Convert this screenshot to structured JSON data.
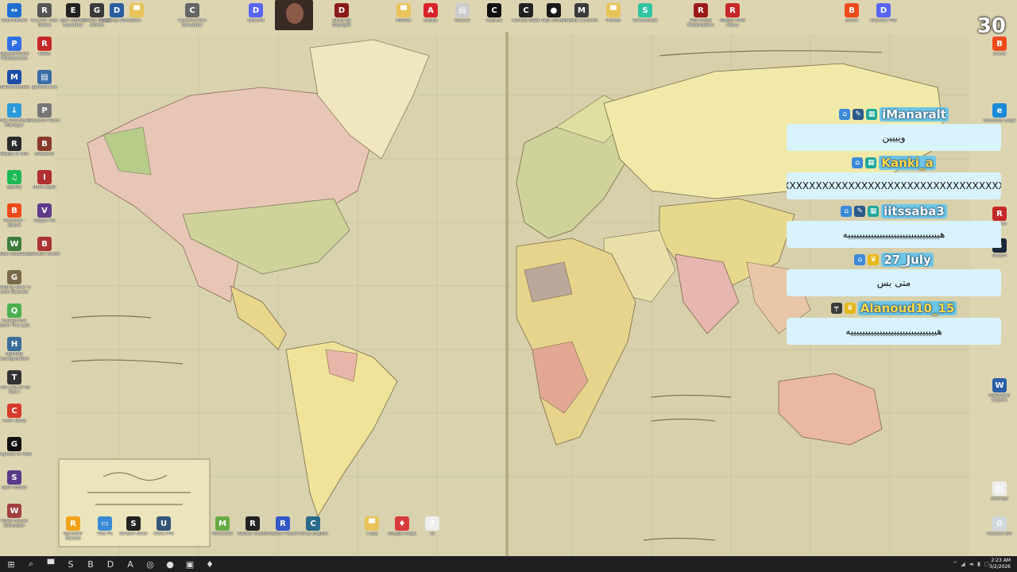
{
  "counter": "30",
  "chat": [
    {
      "user": "iManaralt",
      "badges": [
        "subscriber",
        "pen",
        "game"
      ],
      "text": "ويييين",
      "name_color": "#ffffff"
    },
    {
      "user": "Kanki_a",
      "badges": [
        "subscriber",
        "game"
      ],
      "text": "XXXXXXXXXXXXXXXXXXXXXXXXXXXXXXXXXXXXXX",
      "name_color": "#ffd84a"
    },
    {
      "user": "iitssaba3",
      "badges": [
        "subscriber",
        "pen",
        "game"
      ],
      "text": "هييييييييييييييييييييييييييييييييه",
      "name_color": "#ffffff"
    },
    {
      "user": "27_July",
      "badges": [
        "subscriber",
        "crown"
      ],
      "text": "متى بس",
      "name_color": "#ffffff"
    },
    {
      "user": "Alanoud10_15",
      "badges": [
        "gun",
        "crown"
      ],
      "text": "هييييييييييييييييييييييييييييييه",
      "name_color": "#ffd84a"
    }
  ],
  "desktop_left": [
    {
      "label": "TeamViewer",
      "icon": "teamviewer-icon",
      "color": "#1f6fd1",
      "glyph": "↔"
    },
    {
      "label": "Wondershare PDFelement",
      "icon": "pdfelement-icon",
      "color": "#2f6ee8",
      "glyph": "P"
    },
    {
      "label": "Malwarebytes",
      "icon": "malwarebytes-icon",
      "color": "#1d4ea8",
      "glyph": "M"
    },
    {
      "label": "Free Download Manager",
      "icon": "fdm-icon",
      "color": "#2b9ad8",
      "glyph": "↓"
    },
    {
      "label": "Ready or Not",
      "icon": "ready-or-not-icon",
      "color": "#2a2a2a",
      "glyph": "R"
    },
    {
      "label": "Spotify",
      "icon": "spotify-icon",
      "color": "#1db954",
      "glyph": "♫"
    },
    {
      "label": "Personal - Brave",
      "icon": "brave-icon",
      "color": "#f04a1c",
      "glyph": "B"
    },
    {
      "label": "Wisk Macbook",
      "icon": "wisk-icon",
      "color": "#3d7c3d",
      "glyph": "W"
    },
    {
      "label": "Getting Over It with Bennett",
      "icon": "getting-over-it-icon",
      "color": "#7a6a4a",
      "glyph": "G"
    },
    {
      "label": "Quarantine Zone The Last",
      "icon": "quarantine-zone-icon",
      "color": "#4caf50",
      "glyph": "Q"
    },
    {
      "label": "HidHide Configuration",
      "icon": "hidhide-icon",
      "color": "#3c6e9a",
      "glyph": "H"
    },
    {
      "label": "The Last of Us Part I",
      "icon": "last-of-us-icon",
      "color": "#333333",
      "glyph": "T"
    },
    {
      "label": "Core Temp",
      "icon": "core-temp-icon",
      "color": "#d83b2b",
      "glyph": "C"
    },
    {
      "label": "Logitech G HUB",
      "icon": "logitech-icon",
      "color": "#111111",
      "glyph": "G"
    },
    {
      "label": "Split Fiction",
      "icon": "split-fiction-icon",
      "color": "#5a3a8a",
      "glyph": "S"
    },
    {
      "label": "Wrap House Simulator",
      "icon": "wrap-house-icon",
      "color": "#a04040",
      "glyph": "W"
    }
  ],
  "desktop_left2": [
    {
      "label": "R.E.P.O. Like Demo",
      "icon": "repo-icon",
      "color": "#555555",
      "glyph": "R"
    },
    {
      "label": "RAGE",
      "icon": "rage-icon",
      "color": "#c62828",
      "glyph": "R"
    },
    {
      "label": "getfiles.exe",
      "icon": "file-icon",
      "color": "#3a6ea5",
      "glyph": "▤"
    },
    {
      "label": "Phasmo Patch",
      "icon": "phasmo-icon",
      "color": "#777777",
      "glyph": "P"
    },
    {
      "label": "Bidwarfy",
      "icon": "bidwarfy-icon",
      "color": "#8a3a2a",
      "glyph": "B"
    },
    {
      "label": "IMPA label",
      "icon": "impa-icon",
      "color": "#b03030",
      "glyph": "I"
    },
    {
      "label": "Vegas Pro",
      "icon": "vegas-icon",
      "color": "#5e3b8c",
      "glyph": "V"
    },
    {
      "label": "Blooble Shoot",
      "icon": "blooble-icon",
      "color": "#a33",
      "glyph": "B"
    }
  ],
  "desktop_top": [
    {
      "label": "Epic Games Launcher",
      "icon": "epic-games-icon",
      "color": "#222222",
      "glyph": "E"
    },
    {
      "label": "Check Ghost Admin",
      "icon": "ghost-icon",
      "color": "#3a3a3a",
      "glyph": "G"
    },
    {
      "label": "Desktop Ghost",
      "icon": "desktop-ghost-icon",
      "color": "#2a5ea0",
      "glyph": "D"
    },
    {
      "label": "Sim",
      "icon": "folder-icon",
      "color": "#e8c45a",
      "glyph": "▀"
    },
    {
      "label": "Construction Simulator",
      "icon": "construction-icon",
      "color": "#666666",
      "glyph": "C"
    },
    {
      "label": "Discord",
      "icon": "discord-icon",
      "color": "#5865f2",
      "glyph": "D"
    },
    {
      "label": "Dead by Daylight",
      "icon": "dbd-icon",
      "color": "#8a1a1a",
      "glyph": "D"
    },
    {
      "label": "NVIDIA",
      "icon": "folder-icon",
      "color": "#e8c45a",
      "glyph": "▀"
    },
    {
      "label": "Adobe",
      "icon": "adobe-icon",
      "color": "#d8232a",
      "glyph": "A"
    },
    {
      "label": "Unsure",
      "icon": "file-icon",
      "color": "#cccccc",
      "glyph": "▤"
    },
    {
      "label": "CapCut",
      "icon": "capcut-icon",
      "color": "#111111",
      "glyph": "C"
    },
    {
      "label": "Control Deck",
      "icon": "control-deck-icon",
      "color": "#222222",
      "glyph": "C"
    },
    {
      "label": "OBS Studio",
      "icon": "obs-icon",
      "color": "#1a1a1a",
      "glyph": "●"
    },
    {
      "label": "Media Controls",
      "icon": "media-icon",
      "color": "#3a3a3a",
      "glyph": "M"
    },
    {
      "label": "Photos",
      "icon": "folder-icon",
      "color": "#e8c45a",
      "glyph": "▀"
    },
    {
      "label": "Streamlabs",
      "icon": "streamlabs-icon",
      "color": "#31c3a2",
      "glyph": "S"
    },
    {
      "label": "Red Dead Redemption",
      "icon": "rdr-icon",
      "color": "#9a1a1a",
      "glyph": "R"
    },
    {
      "label": "Roblox Mod Menu",
      "icon": "roblox-mod-icon",
      "color": "#c62828",
      "glyph": "R"
    },
    {
      "label": "Brave",
      "icon": "brave2-icon",
      "color": "#f04a1c",
      "glyph": "B"
    },
    {
      "label": "Discord PTB",
      "icon": "discord-ptb-icon",
      "color": "#5865f2",
      "glyph": "D"
    }
  ],
  "desktop_bottom": [
    {
      "label": "Rockstar Games",
      "icon": "rockstar-icon",
      "color": "#f0a31a",
      "glyph": "R"
    },
    {
      "label": "This PC",
      "icon": "this-pc-icon",
      "color": "#3a8ad8",
      "glyph": "▭"
    },
    {
      "label": "Stream Deck",
      "icon": "stream-deck-icon",
      "color": "#222222",
      "glyph": "S"
    },
    {
      "label": "Ultra FPS",
      "icon": "ultra-fps-icon",
      "color": "#33557a",
      "glyph": "U"
    },
    {
      "label": "Minecraft",
      "icon": "minecraft-icon",
      "color": "#6a4",
      "glyph": "M"
    },
    {
      "label": "Roblox Studio",
      "icon": "roblox-studio-icon",
      "color": "#222222",
      "glyph": "R"
    },
    {
      "label": "Roblox Player",
      "icon": "roblox-player-icon",
      "color": "#3557c8",
      "glyph": "R"
    },
    {
      "label": "Citrus English",
      "icon": "citrus-icon",
      "color": "#2a6a8a",
      "glyph": "C"
    },
    {
      "label": "7-Zip",
      "icon": "folder-icon",
      "color": "#e8c45a",
      "glyph": "▀"
    },
    {
      "label": "Google Maps",
      "icon": "maps-icon",
      "color": "#d83b3b",
      "glyph": "♦"
    },
    {
      "label": "7z",
      "icon": "sevenzip-icon",
      "color": "#eeeeee",
      "glyph": "7"
    }
  ],
  "desktop_right": [
    {
      "label": "Brave",
      "icon": "brave-right-icon",
      "color": "#f04a1c",
      "glyph": "B"
    },
    {
      "label": "Microsoft Edge",
      "icon": "edge-icon",
      "color": "#1b8ad8",
      "glyph": "e"
    },
    {
      "label": "Steam",
      "icon": "steam-icon",
      "color": "#1b2838",
      "glyph": "S"
    },
    {
      "label": "Roblox",
      "icon": "roblox-right-icon",
      "color": "#c62828",
      "glyph": "R"
    },
    {
      "label": "Wallpaper Engine",
      "icon": "wallpaper-engine-icon",
      "color": "#2b5fa8",
      "glyph": "W"
    },
    {
      "label": "settings",
      "icon": "file-icon",
      "color": "#eeeeee",
      "glyph": "▤"
    },
    {
      "label": "Recycle Bin",
      "icon": "recycle-bin-icon",
      "color": "#cfd8dc",
      "glyph": "♻"
    }
  ],
  "taskbar": [
    {
      "icon": "start-icon",
      "glyph": "⊞"
    },
    {
      "icon": "search-icon",
      "glyph": "⌕"
    },
    {
      "icon": "file-explorer-icon",
      "glyph": "▀"
    },
    {
      "icon": "steam-taskbar-icon",
      "glyph": "S"
    },
    {
      "icon": "brave-taskbar-icon",
      "glyph": "B"
    },
    {
      "icon": "discord-taskbar-icon",
      "glyph": "D"
    },
    {
      "icon": "adobe-taskbar-icon",
      "glyph": "A"
    },
    {
      "icon": "chrome-taskbar-icon",
      "glyph": "◎"
    },
    {
      "icon": "obs-taskbar-icon",
      "glyph": "●"
    },
    {
      "icon": "photos-taskbar-icon",
      "glyph": "▣"
    },
    {
      "icon": "maps-taskbar-icon",
      "glyph": "♦"
    }
  ],
  "clock": {
    "time": "2:23 AM",
    "date": "3/2/2026"
  }
}
